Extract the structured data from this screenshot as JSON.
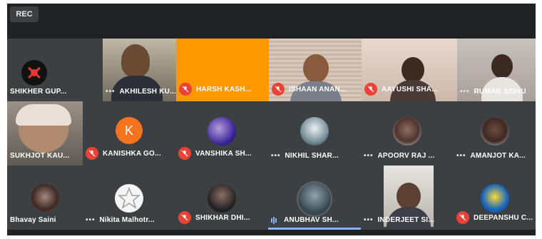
{
  "recording_badge": "REC",
  "colors": {
    "background": "#202124",
    "tile": "#3c4043",
    "muted_mic": "#ea4335",
    "speaking": "#8ab4f8"
  },
  "participants": [
    {
      "name": "SHIKHER GUP...",
      "status": "none",
      "media": "logo"
    },
    {
      "name": "AKHILESH KU...",
      "status": "more-options",
      "media": "video"
    },
    {
      "name": "HARSH KASH...",
      "status": "muted",
      "media": "solid-orange"
    },
    {
      "name": "ISHAAN ANAN...",
      "status": "muted",
      "media": "video"
    },
    {
      "name": "AAYUSHI SHA...",
      "status": "muted",
      "media": "video"
    },
    {
      "name": "RUMAN SIDHU",
      "status": "more-options",
      "media": "video"
    },
    {
      "name": "SUKHJOT KAU...",
      "status": "muted",
      "media": "video"
    },
    {
      "name": "KANISHKA GO...",
      "status": "muted",
      "media": "initial",
      "initial": "K"
    },
    {
      "name": "VANSHIKA SH...",
      "status": "muted",
      "media": "profile-photo"
    },
    {
      "name": "NIKHIL SHAR...",
      "status": "more-options",
      "media": "profile-photo"
    },
    {
      "name": "APOORV RAJ ...",
      "status": "more-options",
      "media": "profile-photo"
    },
    {
      "name": "AMANJOT KA...",
      "status": "more-options",
      "media": "profile-photo"
    },
    {
      "name": "Bhavay Saini",
      "status": "none",
      "media": "profile-photo"
    },
    {
      "name": "Nikita Malhotr...",
      "status": "more-options",
      "media": "profile-photo"
    },
    {
      "name": "SHIKHAR DHI...",
      "status": "muted",
      "media": "profile-photo"
    },
    {
      "name": "ANUBHAV SH...",
      "status": "speaking",
      "media": "profile-photo"
    },
    {
      "name": "INDERJEET SI...",
      "status": "more-options",
      "media": "video"
    },
    {
      "name": "DEEPANSHU C...",
      "status": "muted",
      "media": "profile-photo"
    }
  ]
}
